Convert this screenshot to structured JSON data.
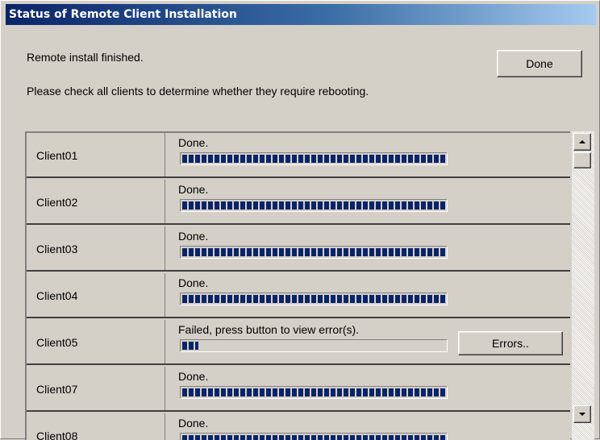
{
  "window": {
    "title": "Status of Remote Client Installation"
  },
  "message": {
    "line1": "Remote install finished.",
    "line2": "Please check all clients to determine whether they require rebooting."
  },
  "buttons": {
    "done": "Done",
    "errors": "Errors.."
  },
  "clients": [
    {
      "name": "Client01",
      "status": "Done.",
      "progress": 1.0
    },
    {
      "name": "Client02",
      "status": "Done.",
      "progress": 1.0
    },
    {
      "name": "Client03",
      "status": "Done.",
      "progress": 1.0
    },
    {
      "name": "Client04",
      "status": "Done.",
      "progress": 1.0
    },
    {
      "name": "Client05",
      "status": "Failed, press button to view error(s).",
      "progress": 0.06,
      "has_errors_button": true
    },
    {
      "name": "Client07",
      "status": "Done.",
      "progress": 1.0
    },
    {
      "name": "Client08",
      "status": "Done.",
      "progress": 1.0
    }
  ],
  "colors": {
    "progress_fill": "#0a246a",
    "title_start": "#0a246a",
    "title_end": "#a6caf0"
  },
  "icons": {
    "scroll_up": "scroll-up-arrow",
    "scroll_down": "scroll-down-arrow"
  }
}
